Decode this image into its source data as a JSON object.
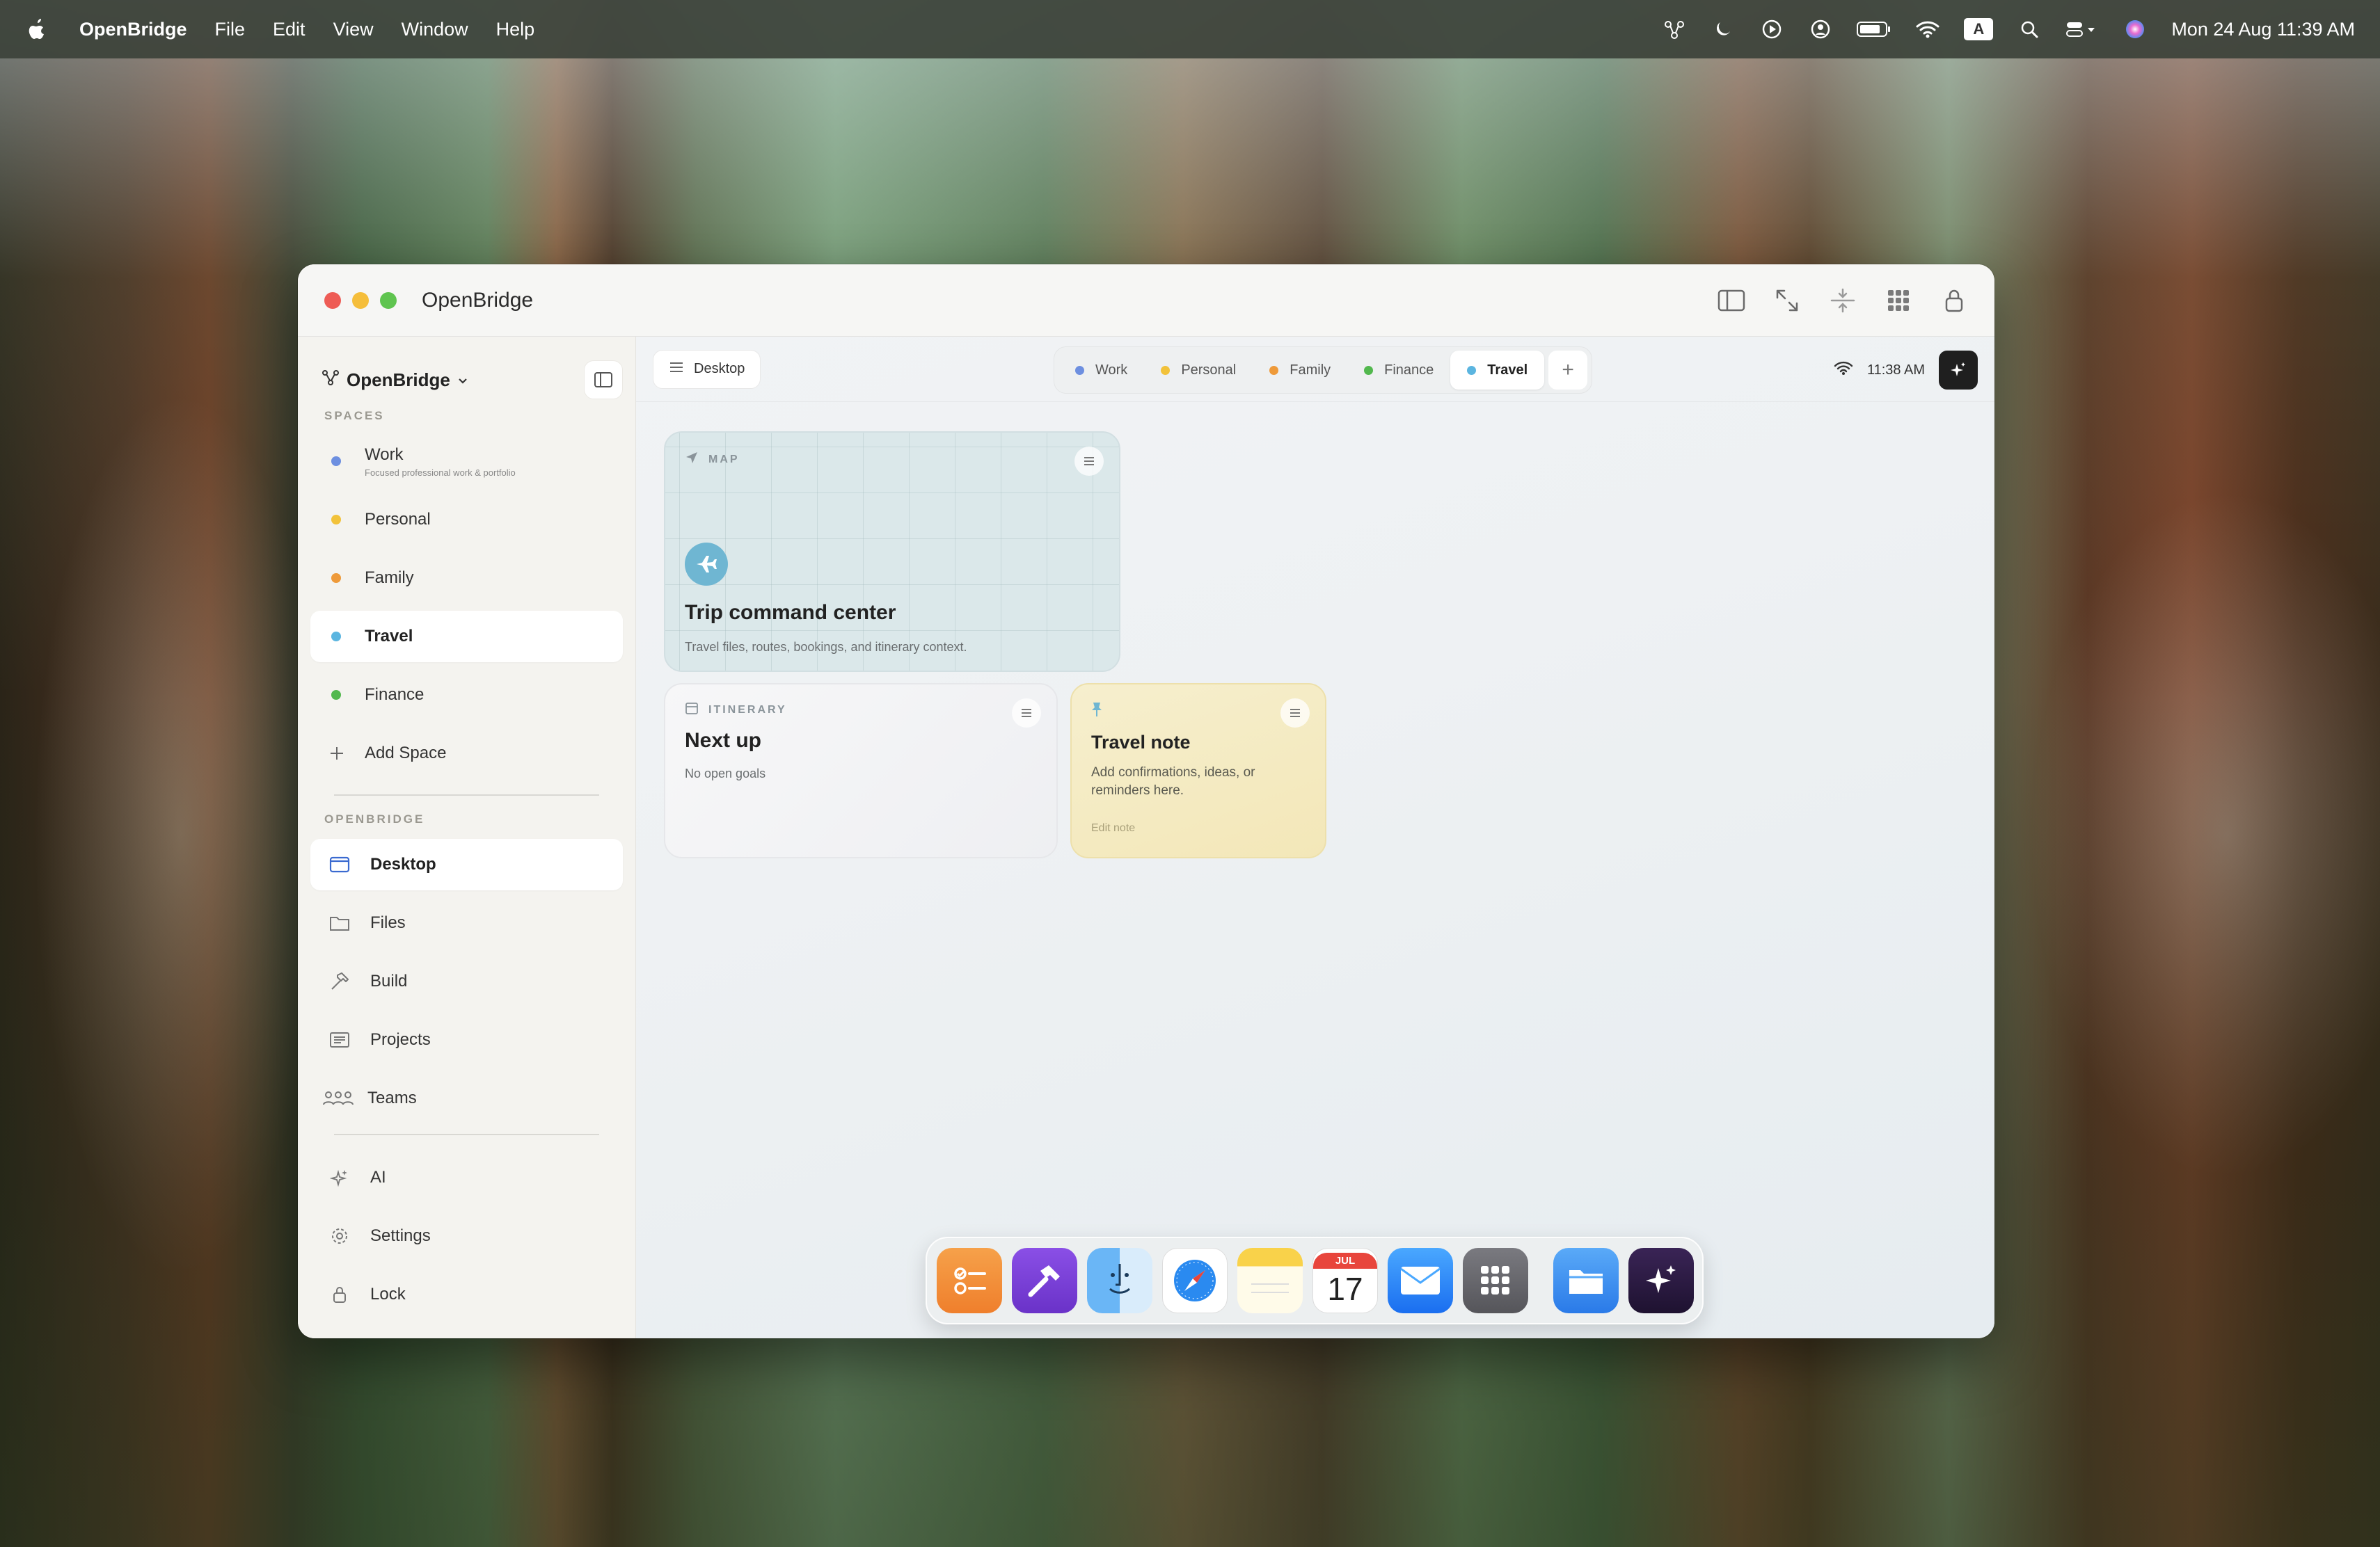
{
  "menubar": {
    "app_name": "OpenBridge",
    "menus": [
      "File",
      "Edit",
      "View",
      "Window",
      "Help"
    ],
    "clock": "Mon 24 Aug  11:39 AM",
    "input_source": "A"
  },
  "window": {
    "title": "OpenBridge"
  },
  "sidebar": {
    "brand": "OpenBridge",
    "spaces_heading": "SPACES",
    "spaces": [
      {
        "label": "Work",
        "sub": "Focused professional work & portfolio",
        "color": "#6d8fe0"
      },
      {
        "label": "Personal",
        "color": "#f2c23a"
      },
      {
        "label": "Family",
        "color": "#ee9a3a"
      },
      {
        "label": "Travel",
        "color": "#5bb5e0"
      },
      {
        "label": "Finance",
        "color": "#52b84e"
      }
    ],
    "add_space": "Add Space",
    "openbridge_heading": "OPENBRIDGE",
    "nav": [
      {
        "label": "Desktop"
      },
      {
        "label": "Files"
      },
      {
        "label": "Build"
      },
      {
        "label": "Projects"
      },
      {
        "label": "Teams"
      }
    ],
    "bottom": [
      {
        "label": "AI"
      },
      {
        "label": "Settings"
      },
      {
        "label": "Lock"
      }
    ]
  },
  "topbar": {
    "desktop_label": "Desktop",
    "tabs": [
      {
        "label": "Work",
        "color": "#6d8fe0"
      },
      {
        "label": "Personal",
        "color": "#f2c23a"
      },
      {
        "label": "Family",
        "color": "#ee9a3a"
      },
      {
        "label": "Finance",
        "color": "#52b84e"
      },
      {
        "label": "Travel",
        "color": "#5bb5e0"
      }
    ],
    "add_tab": "+",
    "time": "11:38 AM"
  },
  "cards": {
    "map": {
      "label": "MAP",
      "title": "Trip command center",
      "desc": "Travel files, routes, bookings, and itinerary context."
    },
    "itinerary": {
      "label": "ITINERARY",
      "title": "Next up",
      "desc": "No open goals"
    },
    "note": {
      "title": "Travel note",
      "desc": "Add confirmations, ideas, or reminders here.",
      "action": "Edit note"
    }
  },
  "dock": {
    "calendar_month": "JUL",
    "calendar_day": "17"
  }
}
